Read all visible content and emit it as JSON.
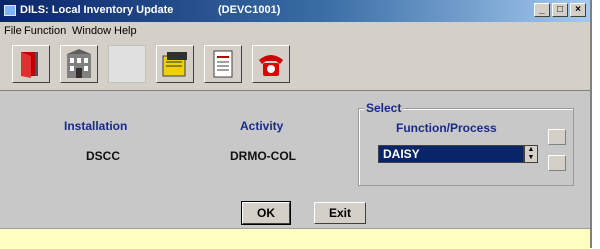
{
  "window": {
    "title": "DILS: Local Inventory Update",
    "subtitle": "(DEVC1001)",
    "controls": [
      "_",
      "□",
      "×"
    ]
  },
  "menu": [
    "File",
    "Function",
    "Window",
    "Help"
  ],
  "toolbar": {
    "buttons": [
      "exit-door-icon",
      "building-icon",
      "blank",
      "folder-note-icon",
      "report-form-icon",
      "telephone-icon"
    ]
  },
  "form": {
    "installation_label": "Installation",
    "installation_value": "DSCC",
    "activity_label": "Activity",
    "activity_value": "DRMO-COL",
    "select_legend": "Select",
    "function_label": "Function/Process",
    "function_value": "DAISY"
  },
  "buttons": {
    "ok_label": "OK",
    "exit_label": "Exit"
  },
  "colors": {
    "title_gradient_start": "#0a246a",
    "label_blue": "#1a2a8a",
    "status_yellow": "#ffffc0"
  }
}
